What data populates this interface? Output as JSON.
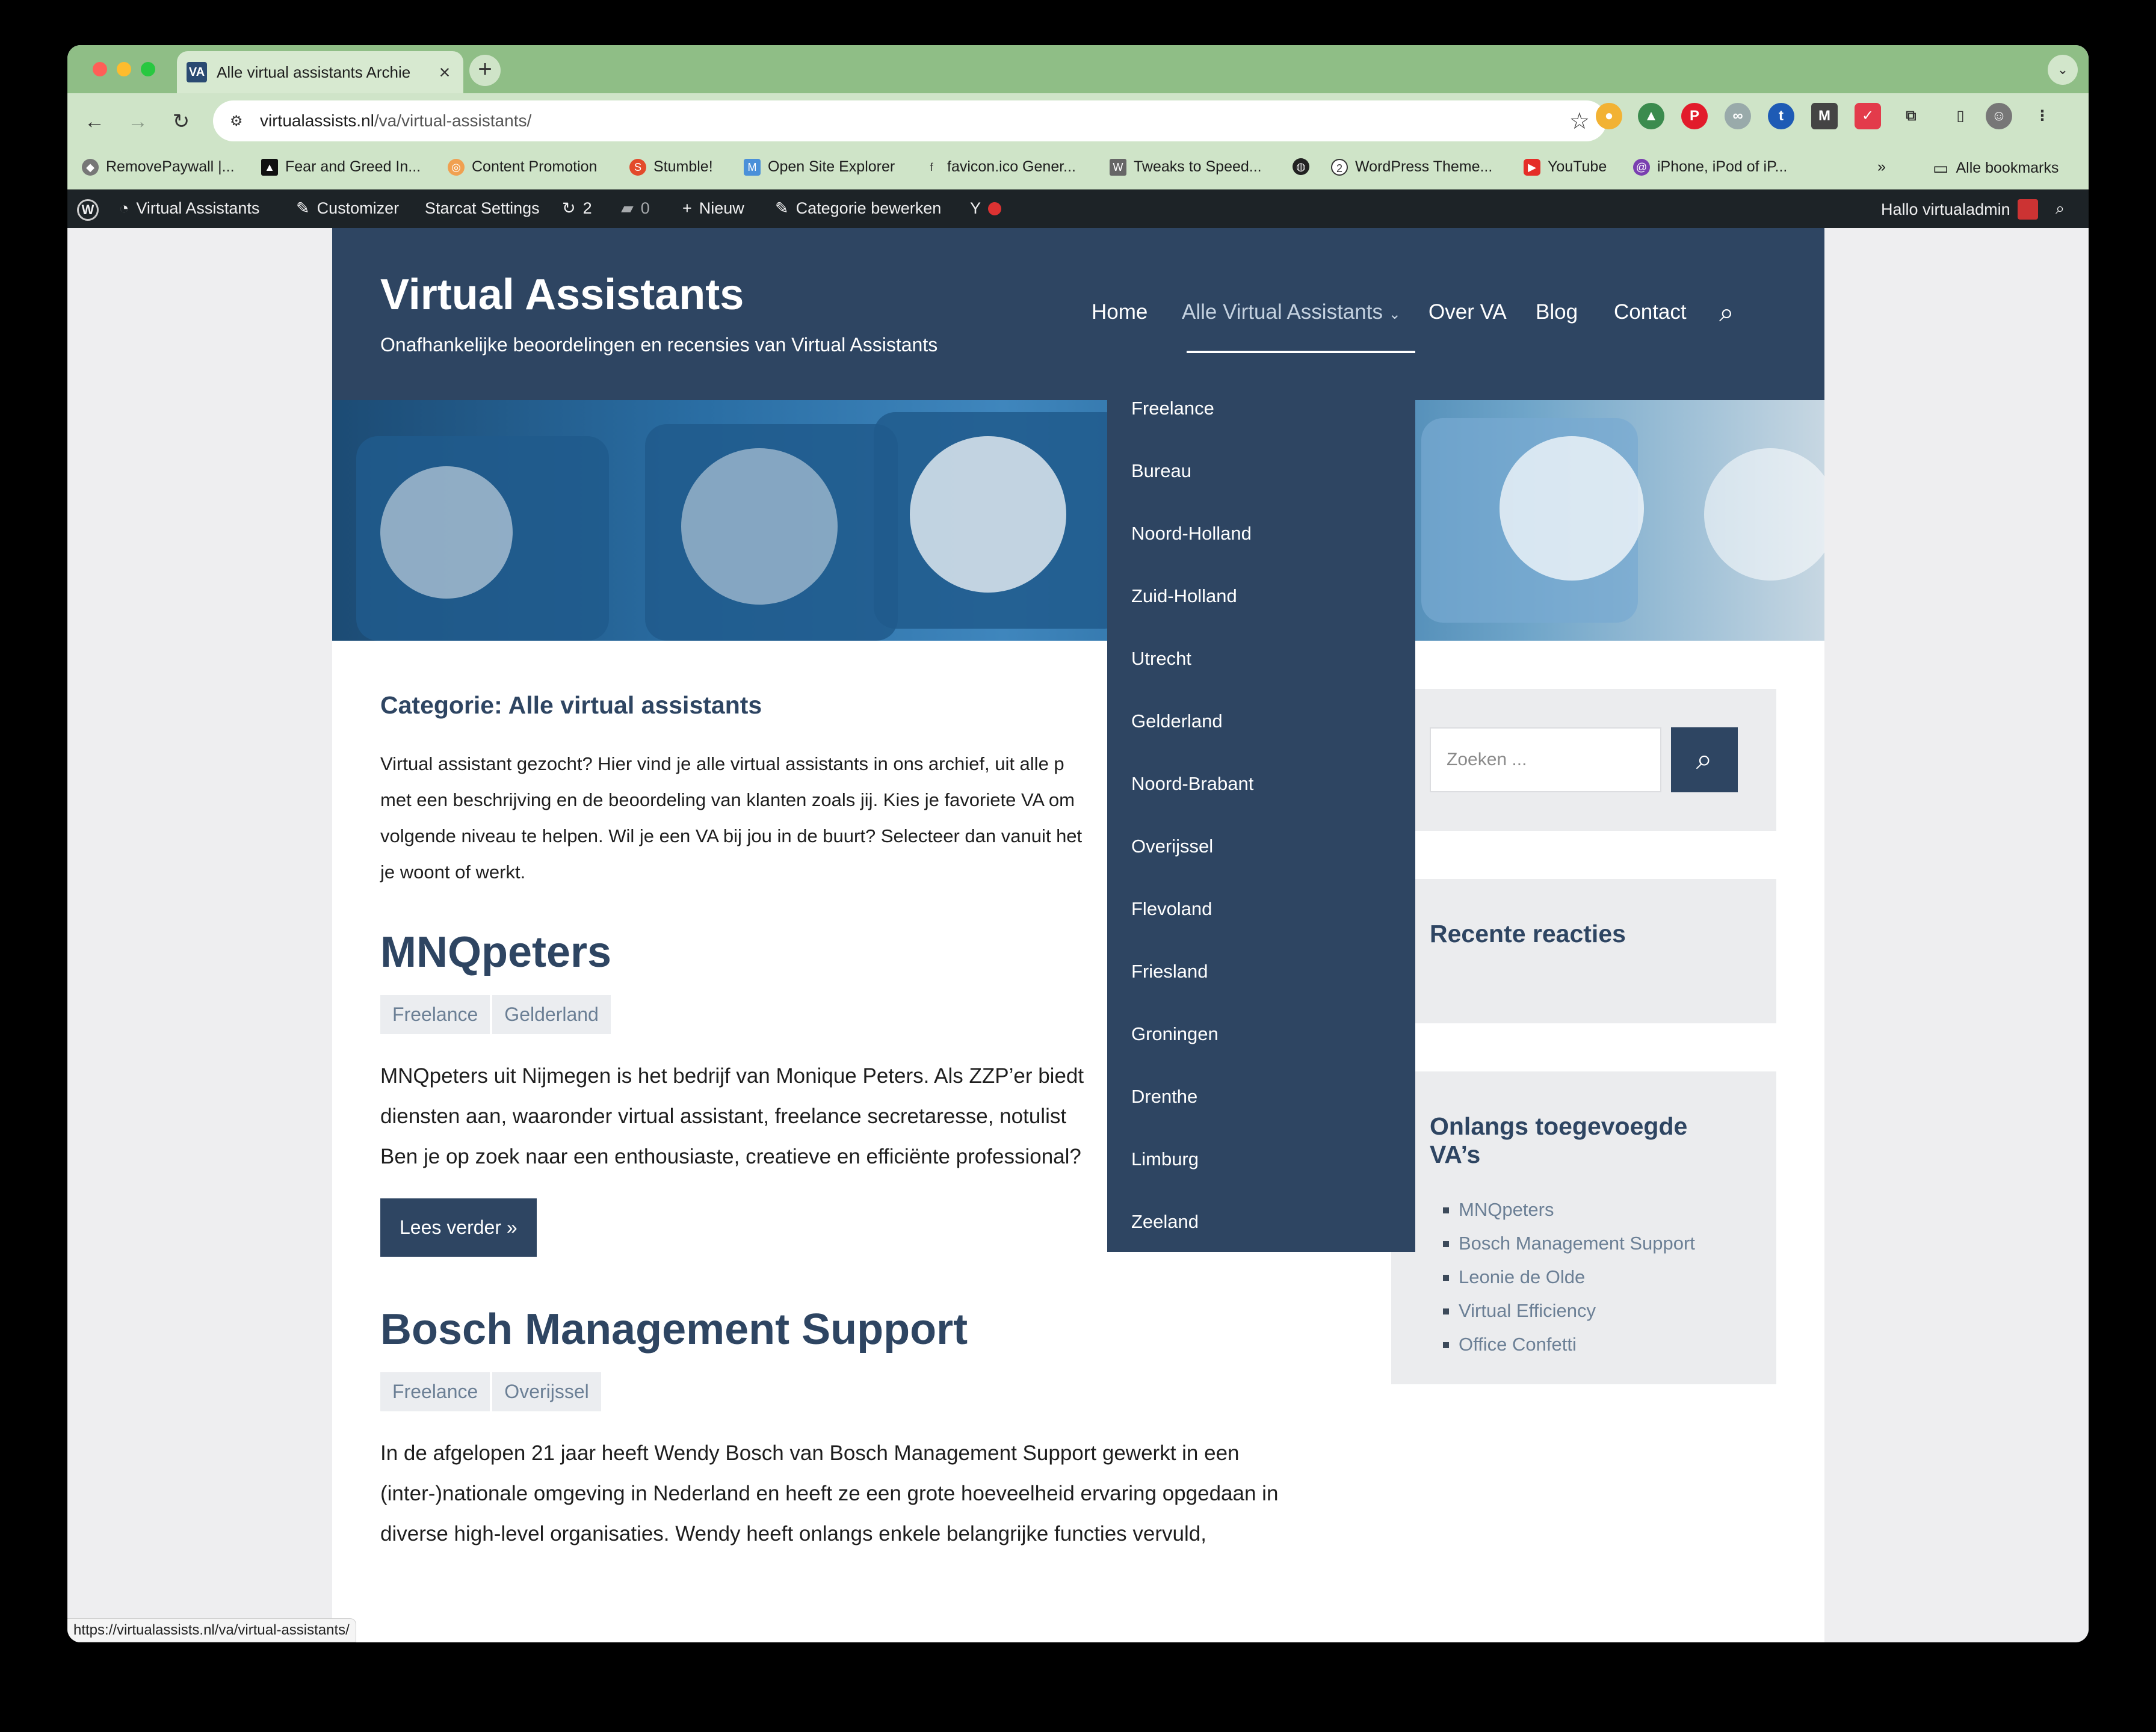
{
  "browser": {
    "tab_title": "Alle virtual assistants Archie",
    "tab_favicon": "VA",
    "url_domain": "virtualassists.nl",
    "url_path": "/va/virtual-assistants/",
    "status_url": "https://virtualassists.nl/va/virtual-assistants/"
  },
  "bookmarks": [
    {
      "label": "RemovePaywall |...",
      "icon": "diamond-icon"
    },
    {
      "label": "Fear and Greed In...",
      "icon": "triangle-icon"
    },
    {
      "label": "Content Promotion",
      "icon": "target-icon"
    },
    {
      "label": "Stumble!",
      "icon": "stumble-icon"
    },
    {
      "label": "Open Site Explorer",
      "icon": "moz-icon"
    },
    {
      "label": "favicon.ico Gener...",
      "icon": "favicon-icon"
    },
    {
      "label": "Tweaks to Speed...",
      "icon": "page-icon"
    },
    {
      "label": "",
      "icon": "globe-icon"
    },
    {
      "label": "WordPress Theme...",
      "icon": "wordpress-icon"
    },
    {
      "label": "YouTube",
      "icon": "youtube-icon"
    },
    {
      "label": "iPhone, iPod of iP...",
      "icon": "at-icon"
    }
  ],
  "all_bookmarks": "Alle bookmarks",
  "adminbar": {
    "site": "Virtual Assistants",
    "customizer": "Customizer",
    "starcat": "Starcat Settings",
    "updates": "2",
    "comments": "0",
    "new": "Nieuw",
    "edit": "Categorie bewerken",
    "greeting": "Hallo virtualadmin"
  },
  "site": {
    "title": "Virtual Assistants",
    "tagline": "Onafhankelijke beoordelingen en recensies van Virtual Assistants"
  },
  "nav": {
    "home": "Home",
    "all": "Alle Virtual Assistants",
    "about": "Over VA",
    "blog": "Blog",
    "contact": "Contact"
  },
  "dropdown": [
    "Freelance",
    "Bureau",
    "Noord-Holland",
    "Zuid-Holland",
    "Utrecht",
    "Gelderland",
    "Noord-Brabant",
    "Overijssel",
    "Flevoland",
    "Friesland",
    "Groningen",
    "Drenthe",
    "Limburg",
    "Zeeland"
  ],
  "main": {
    "category_title": "Categorie: Alle virtual assistants",
    "intro_lines": [
      "Virtual assistant gezocht? Hier vind je alle virtual assistants in ons archief, uit alle p",
      "met een beschrijving en de beoordeling van klanten zoals jij. Kies je favoriete VA om",
      "volgende niveau te helpen. Wil je een VA bij jou in de buurt? Selecteer dan vanuit het",
      "je woont of werkt."
    ],
    "posts": [
      {
        "title": "MNQpeters",
        "tags": [
          "Freelance",
          "Gelderland"
        ],
        "excerpt_lines": [
          "MNQpeters uit Nijmegen is het bedrijf van Monique Peters. Als ZZP’er biedt",
          "diensten aan, waaronder virtual assistant, freelance secretaresse, notulist",
          "Ben je op zoek naar een enthousiaste, creatieve en efficiënte professional?"
        ],
        "read_more": "Lees verder »"
      },
      {
        "title": "Bosch Management Support",
        "tags": [
          "Freelance",
          "Overijssel"
        ],
        "excerpt_lines": [
          "In de afgelopen 21 jaar heeft Wendy Bosch van Bosch Management Support gewerkt in een",
          "(inter-)nationale omgeving in Nederland en heeft ze een grote hoeveelheid ervaring opgedaan in",
          "diverse high-level organisaties. Wendy heeft onlangs enkele belangrijke functies vervuld,"
        ]
      }
    ]
  },
  "sidebar": {
    "search_placeholder": "Zoeken ...",
    "recent_comments": "Recente reacties",
    "recent_vas_title": "Onlangs toegevoegde VA’s",
    "recent_vas": [
      "MNQpeters",
      "Bosch Management Support",
      "Leonie de Olde",
      "Virtual Efficiency",
      "Office Confetti"
    ]
  }
}
